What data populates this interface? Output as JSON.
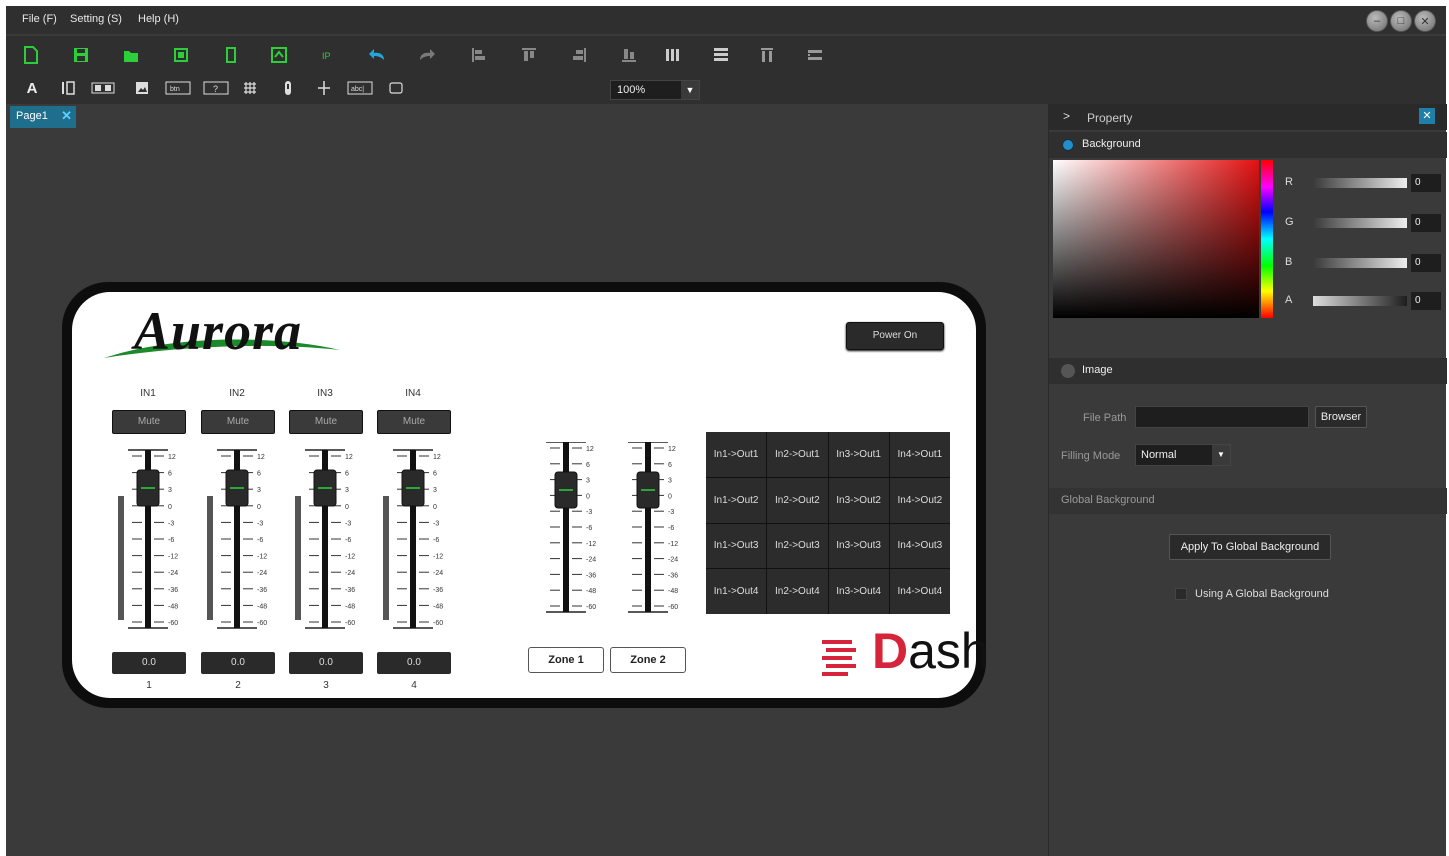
{
  "menu": {
    "file": "File (F)",
    "setting": "Setting (S)",
    "help": "Help (H)"
  },
  "toolbar": {
    "zoom": "100%"
  },
  "tabs": [
    {
      "label": "Page1"
    }
  ],
  "design": {
    "logo": "Aurora",
    "power": "Power On",
    "inputs": [
      "IN1",
      "IN2",
      "IN3",
      "IN4"
    ],
    "mute": "Mute",
    "values": [
      "0.0",
      "0.0",
      "0.0",
      "0.0"
    ],
    "channel_numbers": [
      "1",
      "2",
      "3",
      "4"
    ],
    "scale": [
      "12",
      "6",
      "3",
      "0",
      "-3",
      "-6",
      "-12",
      "-24",
      "-36",
      "-48",
      "-60"
    ],
    "zones": [
      "Zone 1",
      "Zone 2"
    ],
    "matrix": [
      [
        "In1->Out1",
        "In2->Out1",
        "In3->Out1",
        "In4->Out1"
      ],
      [
        "In1->Out2",
        "In2->Out2",
        "In3->Out2",
        "In4->Out2"
      ],
      [
        "In1->Out3",
        "In2->Out3",
        "In3->Out3",
        "In4->Out3"
      ],
      [
        "In1->Out4",
        "In2->Out4",
        "In3->Out4",
        "In4->Out4"
      ]
    ],
    "brand_d": "D",
    "brand_rest": "ash"
  },
  "property": {
    "title": "Property",
    "background": "Background",
    "channels": [
      {
        "label": "R",
        "value": "0"
      },
      {
        "label": "G",
        "value": "0"
      },
      {
        "label": "B",
        "value": "0"
      },
      {
        "label": "A",
        "value": "0"
      }
    ],
    "image": "Image",
    "file_path_label": "File Path",
    "browser": "Browser",
    "filling_mode_label": "Filling Mode",
    "filling_mode_value": "Normal",
    "global_background": "Global Background",
    "apply_global": "Apply To Global Background",
    "using_global": "Using A Global Background"
  }
}
